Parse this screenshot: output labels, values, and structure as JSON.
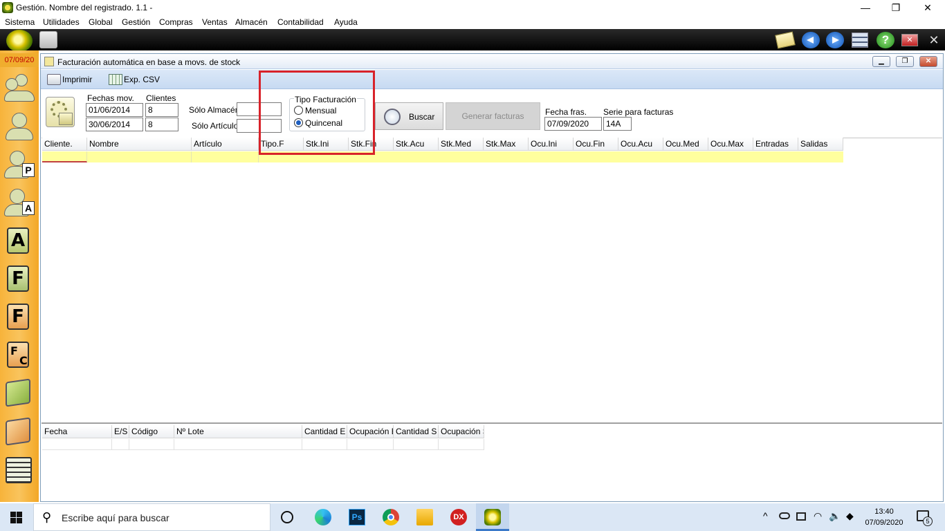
{
  "titlebar": {
    "title": "Gestión. Nombre del registrado. 1.1 -",
    "minimize": "—",
    "restore": "❐",
    "close": "✕"
  },
  "menu": [
    "Sistema",
    "Utilidades",
    "Global",
    "Gestión",
    "Compras",
    "Ventas",
    "Almacén",
    "Contabilidad",
    "Ayuda"
  ],
  "sidebar": {
    "date": "07/09/20",
    "letters": [
      "A",
      "F",
      "F"
    ]
  },
  "window": {
    "title": "Facturación automática en base a movs. de stock",
    "toolbar": {
      "print_label": "Imprimir",
      "export_label": "Exp. CSV"
    },
    "filters": {
      "fechas_label": "Fechas mov.",
      "fecha_desde": "01/06/2014",
      "fecha_hasta": "30/06/2014",
      "clientes_label": "Clientes",
      "cliente_desde": "8",
      "cliente_hasta": "8",
      "almacen_label": "Sólo Almacén",
      "almacen_value": "",
      "articulo_label": "Sólo Artículo",
      "articulo_value": "",
      "tipo_label": "Tipo Facturación",
      "tipo_mensual": "Mensual",
      "tipo_quincenal": "Quincenal",
      "tipo_selected": "Quincenal",
      "buscar_label": "Buscar",
      "generar_label": "Generar facturas",
      "fecha_fras_label": "Fecha fras.",
      "fecha_fras_value": "07/09/2020",
      "serie_label": "Serie para facturas",
      "serie_value": "14A"
    },
    "main_grid": {
      "columns": [
        "Cliente.",
        "Nombre",
        "Artículo",
        "Tipo.F",
        "Stk.Ini",
        "Stk.Fin",
        "Stk.Acu",
        "Stk.Med",
        "Stk.Max",
        "Ocu.Ini",
        "Ocu.Fin",
        "Ocu.Acu",
        "Ocu.Med",
        "Ocu.Max",
        "Entradas",
        "Salidas"
      ]
    },
    "detail_grid": {
      "columns": [
        "Fecha",
        "E/S",
        "Código",
        "Nº Lote",
        "Cantidad E",
        "Ocupación E",
        "Cantidad S",
        "Ocupación S"
      ]
    }
  },
  "taskbar": {
    "search_placeholder": "Escribe aquí para buscar",
    "time": "13:40",
    "date": "07/09/2020",
    "notifications": "5",
    "dx_label": "DX",
    "ps_label": "Ps"
  },
  "colors": {
    "accent_red": "#d8222a",
    "row_highlight": "#ffff9e",
    "sidebar": "#f9c45d"
  }
}
